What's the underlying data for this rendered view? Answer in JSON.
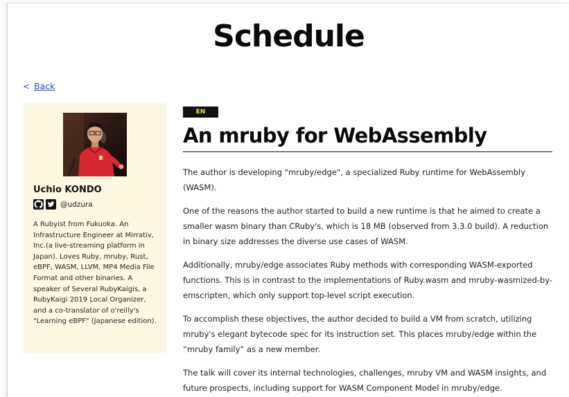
{
  "page": {
    "title": "Schedule"
  },
  "nav": {
    "back_label": "Back",
    "back_chevron": "<"
  },
  "speaker": {
    "name": "Uchio KONDO",
    "handle": "@udzura",
    "bio": "A Rubyist from Fukuoka. An Infrastructure Engineer at Mirrativ, Inc.(a live-streaming platform in Japan). Loves Ruby, mruby, Rust, eBPF, WASM, LLVM, MP4 Media File Format and other binaries. A speaker of Several RubyKaigis, a RubyKaigi 2019 Local Organizer, and a co-translator of o'reilly's \"Learning eBPF\" (Japanese edition).",
    "icons": [
      "github-icon",
      "twitter-icon"
    ]
  },
  "talk": {
    "language": "EN",
    "title": "An mruby for WebAssembly",
    "paragraphs": [
      "The author is developing \"mruby/edge\", a specialized Ruby runtime for WebAssembly (WASM).",
      "One of the reasons the author started to build a new runtime is that he aimed to create a smaller wasm binary than CRuby's, which is 18 MB (observed from 3.3.0 build). A reduction in binary size addresses the diverse use cases of WASM.",
      "Additionally, mruby/edge associates Ruby methods with corresponding WASM-exported functions. This is in contrast to the implementations of Ruby.wasm and mruby-wasmized-by-emscripten, which only support top-level script execution.",
      "To accomplish these objectives, the author decided to build a VM from scratch, utilizing mruby's elegant bytecode spec for its instruction set. This places mruby/edge within the “mruby family” as a new member.",
      "The talk will cover its internal technologies, challenges, mruby VM and WASM insights, and future prospects, including support for WASM Component Model in mruby/edge."
    ]
  },
  "colors": {
    "sidebar_bg": "#fdf8e2",
    "badge_bg": "#111111",
    "badge_text": "#f2e14d",
    "link": "#2a4fa8"
  }
}
